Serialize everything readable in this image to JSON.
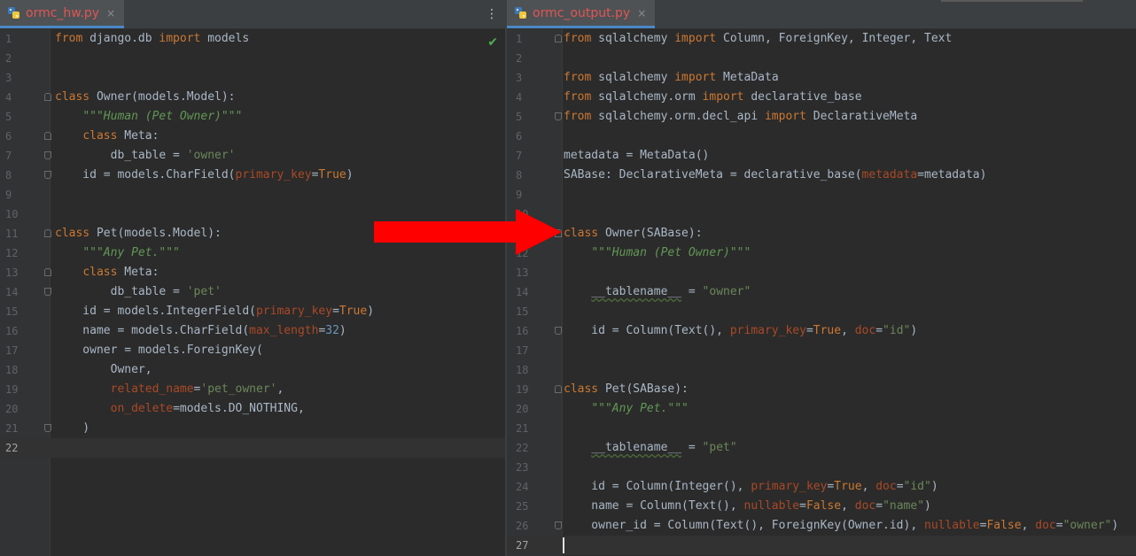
{
  "left": {
    "tab": {
      "filename": "ormc_hw.py",
      "close": "×",
      "icon": "python-file-icon"
    },
    "menu": "⋮",
    "status": "✔",
    "lines": [
      [
        {
          "t": "from",
          "c": "k"
        },
        {
          "t": " django.db "
        },
        {
          "t": "import",
          "c": "k"
        },
        {
          "t": " models"
        }
      ],
      [],
      [],
      [
        {
          "t": "class",
          "c": "k"
        },
        {
          "t": " Owner(models.Model):"
        }
      ],
      [
        {
          "t": "    "
        },
        {
          "t": "\"\"\"Human (Pet Owner)\"\"\"",
          "c": "d"
        }
      ],
      [
        {
          "t": "    "
        },
        {
          "t": "class",
          "c": "k"
        },
        {
          "t": " Meta:"
        }
      ],
      [
        {
          "t": "        db_table = "
        },
        {
          "t": "'owner'",
          "c": "s"
        }
      ],
      [
        {
          "t": "    id = models.CharField("
        },
        {
          "t": "primary_key",
          "c": "p"
        },
        {
          "t": "="
        },
        {
          "t": "True",
          "c": "k"
        },
        {
          "t": ")"
        }
      ],
      [],
      [],
      [
        {
          "t": "class",
          "c": "k"
        },
        {
          "t": " Pet(models.Model):"
        }
      ],
      [
        {
          "t": "    "
        },
        {
          "t": "\"\"\"Any Pet.\"\"\"",
          "c": "d"
        }
      ],
      [
        {
          "t": "    "
        },
        {
          "t": "class",
          "c": "k"
        },
        {
          "t": " Meta:"
        }
      ],
      [
        {
          "t": "        db_table = "
        },
        {
          "t": "'pet'",
          "c": "s"
        }
      ],
      [
        {
          "t": "    id = models.IntegerField("
        },
        {
          "t": "primary_key",
          "c": "p"
        },
        {
          "t": "="
        },
        {
          "t": "True",
          "c": "k"
        },
        {
          "t": ")"
        }
      ],
      [
        {
          "t": "    name = models.CharField("
        },
        {
          "t": "max_length",
          "c": "p"
        },
        {
          "t": "="
        },
        {
          "t": "32",
          "c": "n"
        },
        {
          "t": ")"
        }
      ],
      [
        {
          "t": "    owner = models.ForeignKey("
        }
      ],
      [
        {
          "t": "        Owner,"
        }
      ],
      [
        {
          "t": "        "
        },
        {
          "t": "related_name",
          "c": "p"
        },
        {
          "t": "="
        },
        {
          "t": "'pet_owner'",
          "c": "s"
        },
        {
          "t": ","
        }
      ],
      [
        {
          "t": "        "
        },
        {
          "t": "on_delete",
          "c": "p"
        },
        {
          "t": "=models.DO_NOTHING,"
        }
      ],
      [
        {
          "t": "    )"
        }
      ],
      []
    ],
    "folds": {
      "4": "top",
      "6": "top",
      "7": "bot",
      "8": "bot",
      "11": "top",
      "13": "top",
      "14": "bot",
      "21": "bot"
    },
    "current_line": 22
  },
  "right": {
    "tab": {
      "filename": "ormc_output.py",
      "close": "×",
      "icon": "python-file-icon"
    },
    "lines": [
      [
        {
          "t": "from",
          "c": "k"
        },
        {
          "t": " sqlalchemy "
        },
        {
          "t": "import",
          "c": "k"
        },
        {
          "t": " Column, ForeignKey, Integer, Text"
        }
      ],
      [],
      [
        {
          "t": "from",
          "c": "k"
        },
        {
          "t": " sqlalchemy "
        },
        {
          "t": "import",
          "c": "k"
        },
        {
          "t": " MetaData"
        }
      ],
      [
        {
          "t": "from",
          "c": "k"
        },
        {
          "t": " sqlalchemy.orm "
        },
        {
          "t": "import",
          "c": "k"
        },
        {
          "t": " declarative_base"
        }
      ],
      [
        {
          "t": "from",
          "c": "k"
        },
        {
          "t": " sqlalchemy.orm.decl_api "
        },
        {
          "t": "import",
          "c": "k"
        },
        {
          "t": " DeclarativeMeta"
        }
      ],
      [],
      [
        {
          "t": "metadata = MetaData()"
        }
      ],
      [
        {
          "t": "SABase: DeclarativeMeta = declarative_base("
        },
        {
          "t": "metadata",
          "c": "p"
        },
        {
          "t": "=metadata)"
        }
      ],
      [],
      [],
      [
        {
          "t": "class",
          "c": "k"
        },
        {
          "t": " Owner(SABase):"
        }
      ],
      [
        {
          "t": "    "
        },
        {
          "t": "\"\"\"Human (Pet Owner)\"\"\"",
          "c": "d"
        }
      ],
      [],
      [
        {
          "t": "    "
        },
        {
          "t": "__tablename__",
          "c": "u"
        },
        {
          "t": " = "
        },
        {
          "t": "\"owner\"",
          "c": "s"
        }
      ],
      [],
      [
        {
          "t": "    id = Column(Text(), "
        },
        {
          "t": "primary_key",
          "c": "p"
        },
        {
          "t": "="
        },
        {
          "t": "True",
          "c": "k"
        },
        {
          "t": ", "
        },
        {
          "t": "doc",
          "c": "p"
        },
        {
          "t": "="
        },
        {
          "t": "\"id\"",
          "c": "s"
        },
        {
          "t": ")"
        }
      ],
      [],
      [],
      [
        {
          "t": "class",
          "c": "k"
        },
        {
          "t": " Pet(SABase):"
        }
      ],
      [
        {
          "t": "    "
        },
        {
          "t": "\"\"\"Any Pet.\"\"\"",
          "c": "d"
        }
      ],
      [],
      [
        {
          "t": "    "
        },
        {
          "t": "__tablename__",
          "c": "u"
        },
        {
          "t": " = "
        },
        {
          "t": "\"pet\"",
          "c": "s"
        }
      ],
      [],
      [
        {
          "t": "    id = Column(Integer(), "
        },
        {
          "t": "primary_key",
          "c": "p"
        },
        {
          "t": "="
        },
        {
          "t": "True",
          "c": "k"
        },
        {
          "t": ", "
        },
        {
          "t": "doc",
          "c": "p"
        },
        {
          "t": "="
        },
        {
          "t": "\"id\"",
          "c": "s"
        },
        {
          "t": ")"
        }
      ],
      [
        {
          "t": "    name = Column(Text(), "
        },
        {
          "t": "nullable",
          "c": "p"
        },
        {
          "t": "="
        },
        {
          "t": "False",
          "c": "k"
        },
        {
          "t": ", "
        },
        {
          "t": "doc",
          "c": "p"
        },
        {
          "t": "="
        },
        {
          "t": "\"name\"",
          "c": "s"
        },
        {
          "t": ")"
        }
      ],
      [
        {
          "t": "    owner_id = Column(Text(), ForeignKey(Owner.id), "
        },
        {
          "t": "nullable",
          "c": "p"
        },
        {
          "t": "="
        },
        {
          "t": "False",
          "c": "k"
        },
        {
          "t": ", "
        },
        {
          "t": "doc",
          "c": "p"
        },
        {
          "t": "="
        },
        {
          "t": "\"owner\"",
          "c": "s"
        },
        {
          "t": ")"
        }
      ],
      []
    ],
    "folds": {
      "1": "top",
      "5": "bot",
      "11": "top",
      "16": "bot",
      "19": "top",
      "26": "bot"
    },
    "current_line": 27
  },
  "colors": {
    "arrow": "#ff0000",
    "keyword": "#cc7832",
    "string": "#6a8759",
    "docstring": "#629755",
    "param": "#aa4926",
    "number": "#6897bb"
  }
}
